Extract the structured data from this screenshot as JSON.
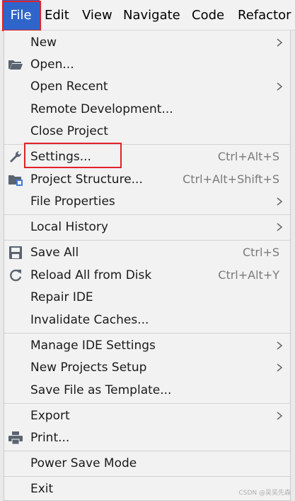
{
  "menubar": {
    "items": [
      "File",
      "Edit",
      "View",
      "Navigate",
      "Code",
      "Refactor"
    ]
  },
  "menu": {
    "new": {
      "label": "New"
    },
    "open": {
      "label": "Open..."
    },
    "open_recent": {
      "label": "Open Recent"
    },
    "remote_development": {
      "label": "Remote Development..."
    },
    "close_project": {
      "label": "Close Project"
    },
    "settings": {
      "label": "Settings...",
      "shortcut": "Ctrl+Alt+S"
    },
    "project_structure": {
      "label": "Project Structure...",
      "shortcut": "Ctrl+Alt+Shift+S"
    },
    "file_properties": {
      "label": "File Properties"
    },
    "local_history": {
      "label": "Local History"
    },
    "save_all": {
      "label": "Save All",
      "shortcut": "Ctrl+S"
    },
    "reload_all": {
      "label": "Reload All from Disk",
      "shortcut": "Ctrl+Alt+Y"
    },
    "repair_ide": {
      "label": "Repair IDE"
    },
    "invalidate_caches": {
      "label": "Invalidate Caches..."
    },
    "manage_ide_settings": {
      "label": "Manage IDE Settings"
    },
    "new_projects_setup": {
      "label": "New Projects Setup"
    },
    "save_file_as_template": {
      "label": "Save File as Template..."
    },
    "export": {
      "label": "Export"
    },
    "print": {
      "label": "Print..."
    },
    "power_save_mode": {
      "label": "Power Save Mode"
    },
    "exit": {
      "label": "Exit"
    }
  },
  "icons": {
    "open": "folder-open-icon",
    "settings": "wrench-icon",
    "project_structure": "project-structure-icon",
    "save_all": "save-icon",
    "reload_all": "reload-icon",
    "print": "printer-icon",
    "submenu": "chevron-right-icon"
  },
  "watermark": "CSDN @吴吴先森",
  "colors": {
    "accent": "#2f65ca",
    "highlight_border": "#e0222a",
    "menu_background": "#f2f2f2",
    "shortcut_text": "#7a7a7a"
  }
}
